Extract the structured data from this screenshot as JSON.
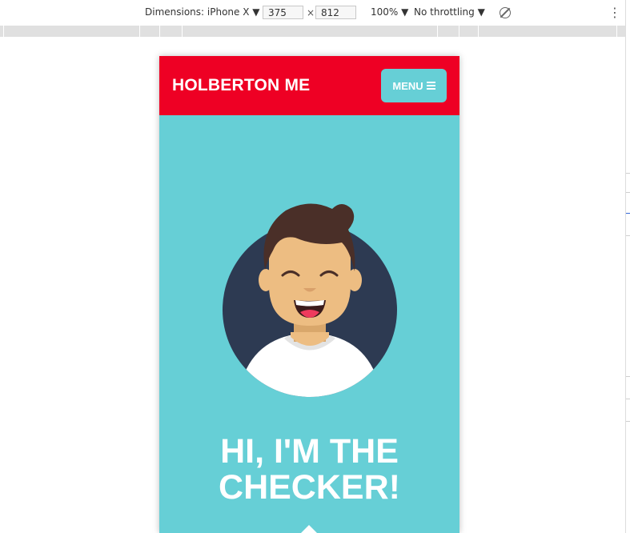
{
  "devtools": {
    "device_label": "Dimensions: iPhone X",
    "width_value": "375",
    "times": "×",
    "height_value": "812",
    "zoom": "100%",
    "throttling": "No throttling",
    "caret": "▼",
    "more": "⋮"
  },
  "site": {
    "logo": "HOLBERTON ME",
    "menu_label": "MENU",
    "hero_title_line1": "HI, I'M THE",
    "hero_title_line2": "CHECKER!"
  },
  "colors": {
    "header_red": "#ee0024",
    "teal": "#66cfd6",
    "avatar_bg": "#2d3a52",
    "hair": "#4a2f28",
    "skin": "#edbd82"
  },
  "icons": [
    "hamburger-icon",
    "rotate-icon",
    "more-icon",
    "scroll-up-arrow-icon"
  ]
}
